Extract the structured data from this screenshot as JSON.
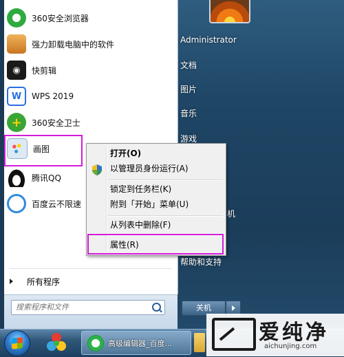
{
  "user": {
    "name": "Administrator"
  },
  "programs": [
    {
      "label": "360安全浏览器",
      "icon": "360-browser-icon",
      "color": "#2faa3f"
    },
    {
      "label": "强力卸载电脑中的软件",
      "icon": "uninstall-box-icon",
      "color": "#d9822b"
    },
    {
      "label": "快剪辑",
      "icon": "kuaijianji-icon",
      "color": "#1a1a1a"
    },
    {
      "label": "WPS 2019",
      "icon": "wps-icon",
      "color": "#2a6fe0"
    },
    {
      "label": "360安全卫士",
      "icon": "360-guard-icon",
      "color": "#3aa636"
    },
    {
      "label": "画图",
      "icon": "paint-icon",
      "color": "#6aa0d8"
    },
    {
      "label": "腾讯QQ",
      "icon": "qq-penguin-icon",
      "color": "#111111"
    },
    {
      "label": "百度云不限速",
      "icon": "baidu-cloud-icon",
      "color": "#2f8be0"
    }
  ],
  "all_programs": "所有程序",
  "search_placeholder": "搜索程序和文件",
  "right_menu": [
    "文档",
    "图片",
    "音乐",
    "游戏"
  ],
  "right_partial_item": "机",
  "help_item": "帮助和支持",
  "shutdown_label": "关机",
  "context_menu": {
    "open": "打开(O)",
    "run_as_admin": "以管理员身份运行(A)",
    "pin_taskbar": "锁定到任务栏(K)",
    "pin_start": "附到「开始」菜单(U)",
    "remove_list": "从列表中删除(F)",
    "properties": "属性(R)"
  },
  "taskbar": {
    "task_label": "高级编辑器_百度..."
  },
  "watermark": {
    "text": "爱纯净",
    "url": "aichunjing.com"
  },
  "highlight_color": "#d31bd8"
}
